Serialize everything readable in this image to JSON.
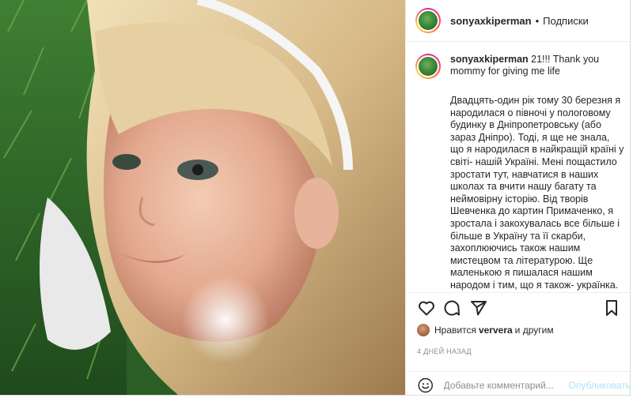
{
  "header": {
    "username": "sonyaxkiperman",
    "separator": "•",
    "follow_label": "Подписки"
  },
  "caption": {
    "username": "sonyaxkiperman",
    "lead": "21!!! Thank you mommy for giving me life",
    "body": "Двадцять-один рік тому 30 березня я народилася о півночі у пологовому будинку в Дніпропетровську (або зараз Дніпро). Тоді, я ще не знала, що я народилася в найкращій країні у світі- нашій Україні. Мені пощастило зростати тут, навчатися в наших школах та вчити нашу багату та неймовірну історію. Від творів Шевченка до картин Примаченко, я зростала і закохувалась все більше і більше в Україну та її скарби, захоплюючись також нашим мистецвом та літературою. Ще маленькою я пишалася нашим народом і тим, що я також- українка."
  },
  "actions": {
    "like_icon": "heart-icon",
    "comment_icon": "comment-icon",
    "share_icon": "paper-plane-icon",
    "save_icon": "bookmark-icon"
  },
  "likes": {
    "prefix": "Нравится",
    "user": "ververa",
    "suffix": "и другим"
  },
  "date": "4 ДНЕЙ НАЗАД",
  "comment": {
    "emoji_icon": "smiley-icon",
    "placeholder": "Добавьте комментарий...",
    "publish_label": "Опубликовать"
  }
}
